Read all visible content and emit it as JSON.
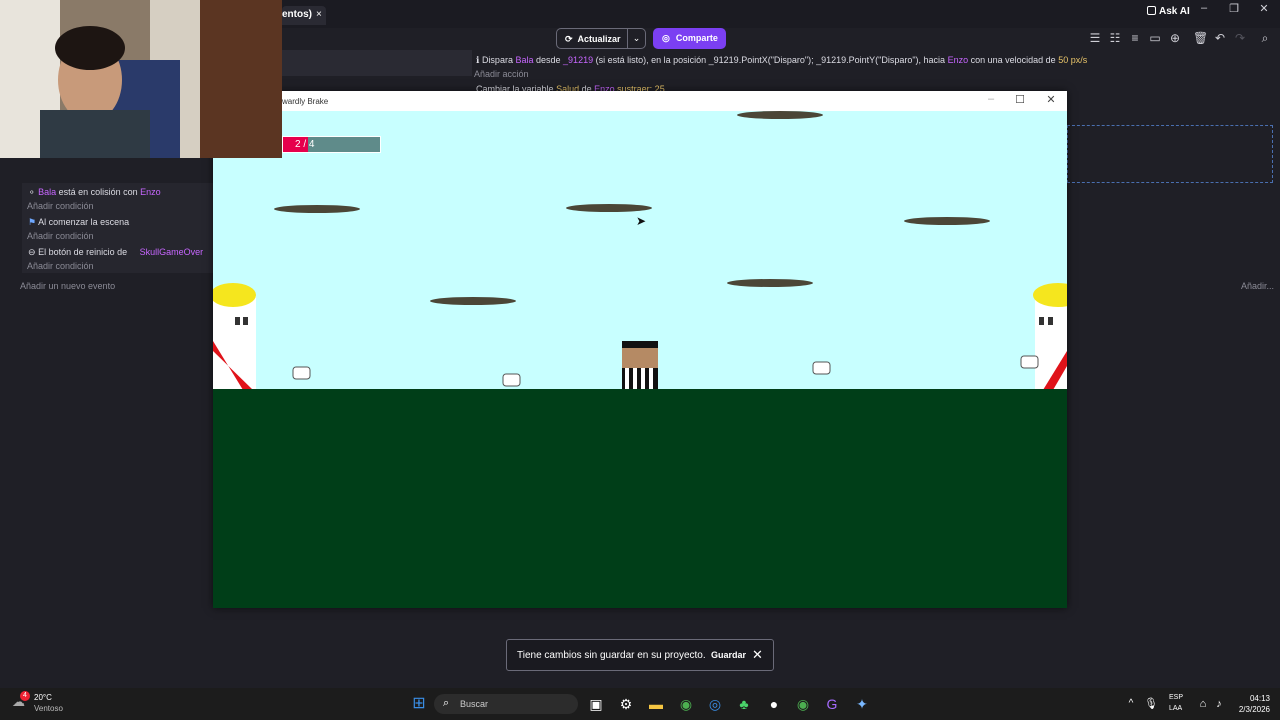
{
  "editor": {
    "tab_label": "entos)",
    "tab_close": "×",
    "ask_ai": "Ask AI",
    "update_label": "Actualizar",
    "share_label": "Comparte",
    "actions": {
      "line1_prefix": "Dispara",
      "bala": "Bala",
      "desde": "desde",
      "obj_id": "_91219",
      "rest": "(si está listo), en la posición _91219.PointX(\"Disparo\"); _91219.PointY(\"Disparo\"), hacia",
      "enzo": "Enzo",
      "rest2": "con una velocidad de",
      "speed": "50 px/s",
      "add_action": "Añadir acción",
      "line2": "Cambiar la variable",
      "line2_var": "Salud",
      "line2_de": "de",
      "line2_obj": "Enzo",
      "line2_op": "sustraer: 25"
    },
    "conditions": [
      {
        "prefix": "",
        "bala": "Bala",
        "mid": "está en colisión con",
        "obj": "Enzo",
        "add": "Añadir condición"
      },
      {
        "prefix": "Al comenzar la escena",
        "add": "Añadir condición"
      },
      {
        "prefix": "El botón de reinicio de",
        "obj": "SkullGameOver",
        "add": "Añadir condición"
      }
    ],
    "add_event": "Añadir un nuevo evento",
    "add_right": "Añadir..."
  },
  "game_window": {
    "title": "wardly Brake",
    "health_text": "2 / 4",
    "health_fraction": 0.5
  },
  "toast": {
    "message": "Tiene cambios sin guardar en su proyecto.",
    "save": "Guardar"
  },
  "taskbar": {
    "weather_temp": "20°C",
    "weather_desc": "Ventoso",
    "weather_badge": "4",
    "search_placeholder": "Buscar",
    "lang": "ESP",
    "lang2": "LAA",
    "time": "04:13",
    "date": "2/3/2026"
  },
  "colors": {
    "accent": "#7b3ff2",
    "sky": "#c8ffff",
    "ground": "#003e18",
    "health": "#e6004c"
  }
}
